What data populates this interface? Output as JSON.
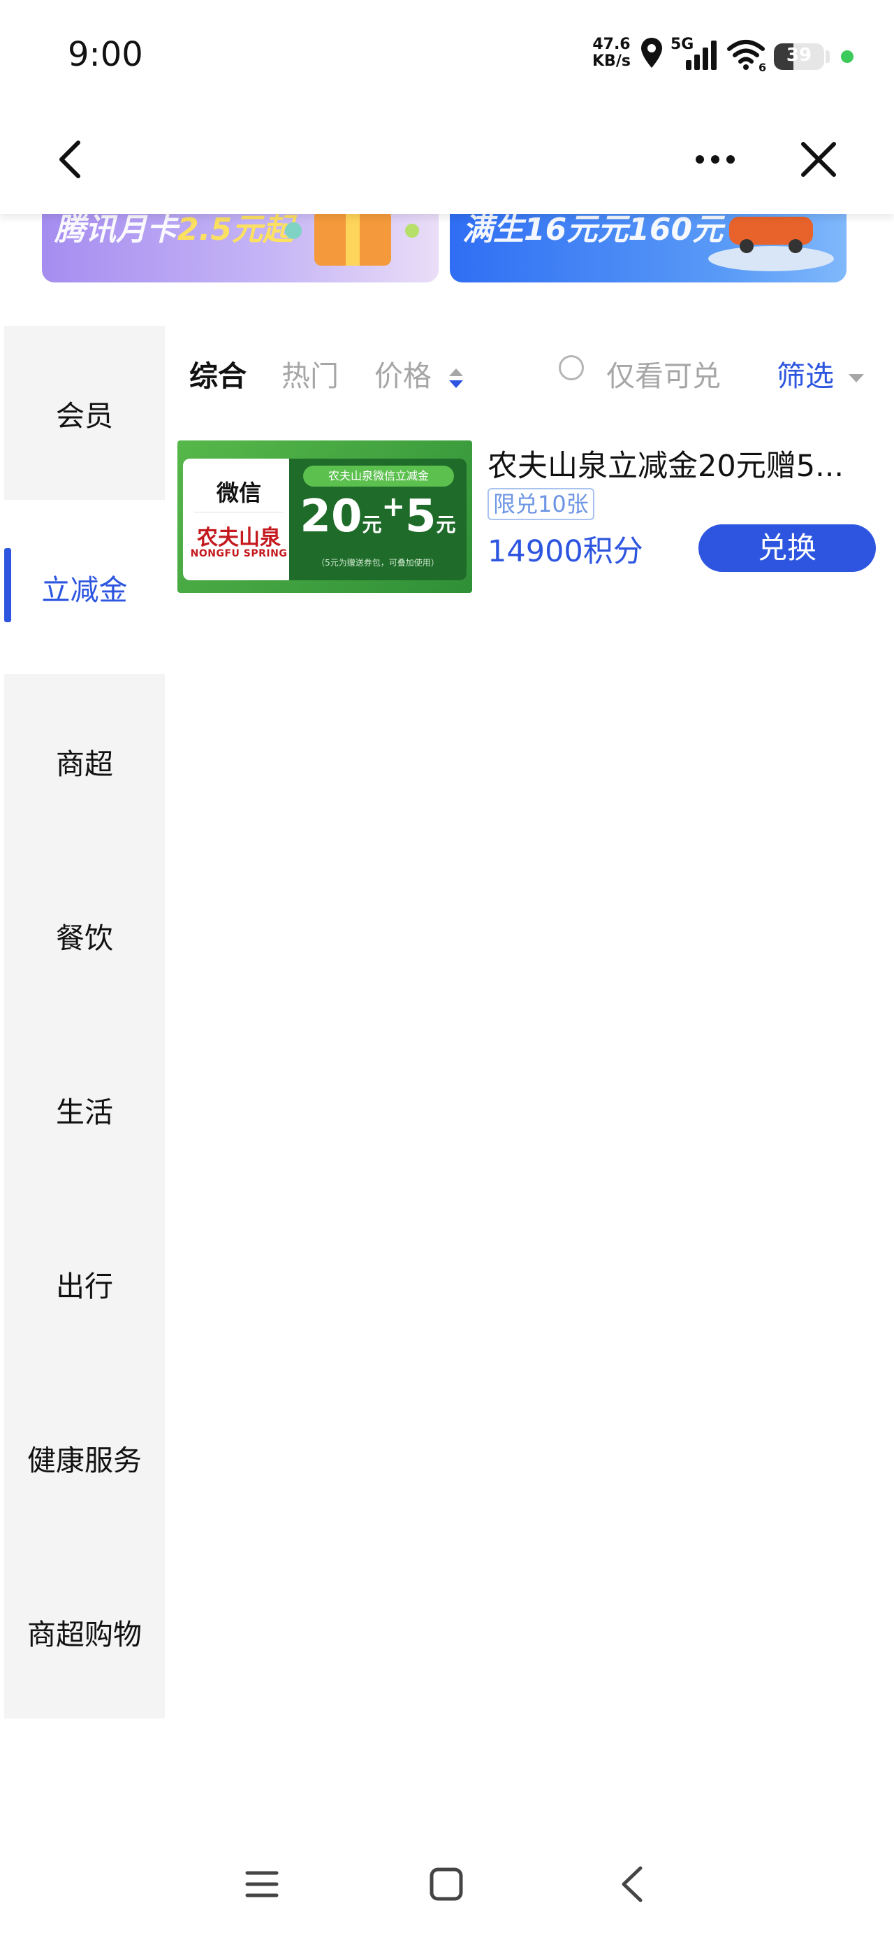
{
  "status_bar": {
    "time": "9:00",
    "net_speed_value": "47.6",
    "net_speed_unit": "KB/s",
    "network_type": "5G",
    "wifi_badge": "6",
    "battery_level": "39",
    "battery_fraction": 0.39,
    "dot_color": "#3ccb5a"
  },
  "header": {
    "back_icon": "chevron-left-icon",
    "more_icon": "more-horizontal-icon",
    "close_icon": "close-icon"
  },
  "banners": {
    "left_text_a": "腾讯月卡",
    "left_text_b": "2.5元起",
    "right_text": "满生16元元160元"
  },
  "sidebar": {
    "items": [
      {
        "label": "会员"
      },
      {
        "label": "立减金"
      },
      {
        "label": "商超"
      },
      {
        "label": "餐饮"
      },
      {
        "label": "生活"
      },
      {
        "label": "出行"
      },
      {
        "label": "健康服务"
      },
      {
        "label": "商超购物"
      }
    ],
    "active_index": 1
  },
  "filters": {
    "tabs": [
      "综合",
      "热门",
      "价格"
    ],
    "active_tab": "综合",
    "only_available_label": "仅看可兑",
    "filter_label": "筛选"
  },
  "products": [
    {
      "title": "农夫山泉立减金20元赠5...",
      "limit_tag": "限兑10张",
      "points": "14900积分",
      "button_label": "兑换",
      "thumb": {
        "wechat": "微信",
        "brand_cn": "农夫山泉",
        "brand_en": "NONGFU SPRING",
        "pill_text": "农夫山泉微信立减金",
        "amount_main": "20",
        "unit_a": "元",
        "plus": "+",
        "amount_bonus": "5",
        "unit_b": "元",
        "note": "（5元为赠送券包，可叠加使用）"
      }
    }
  ],
  "nav": {
    "menu_icon": "menu-icon",
    "home_icon": "home-square-icon",
    "back_icon": "back-triangle-icon"
  },
  "colors": {
    "accent": "#2d55e0",
    "sidebar_bg": "#f4f4f4",
    "muted_text": "#a6a6a6"
  }
}
